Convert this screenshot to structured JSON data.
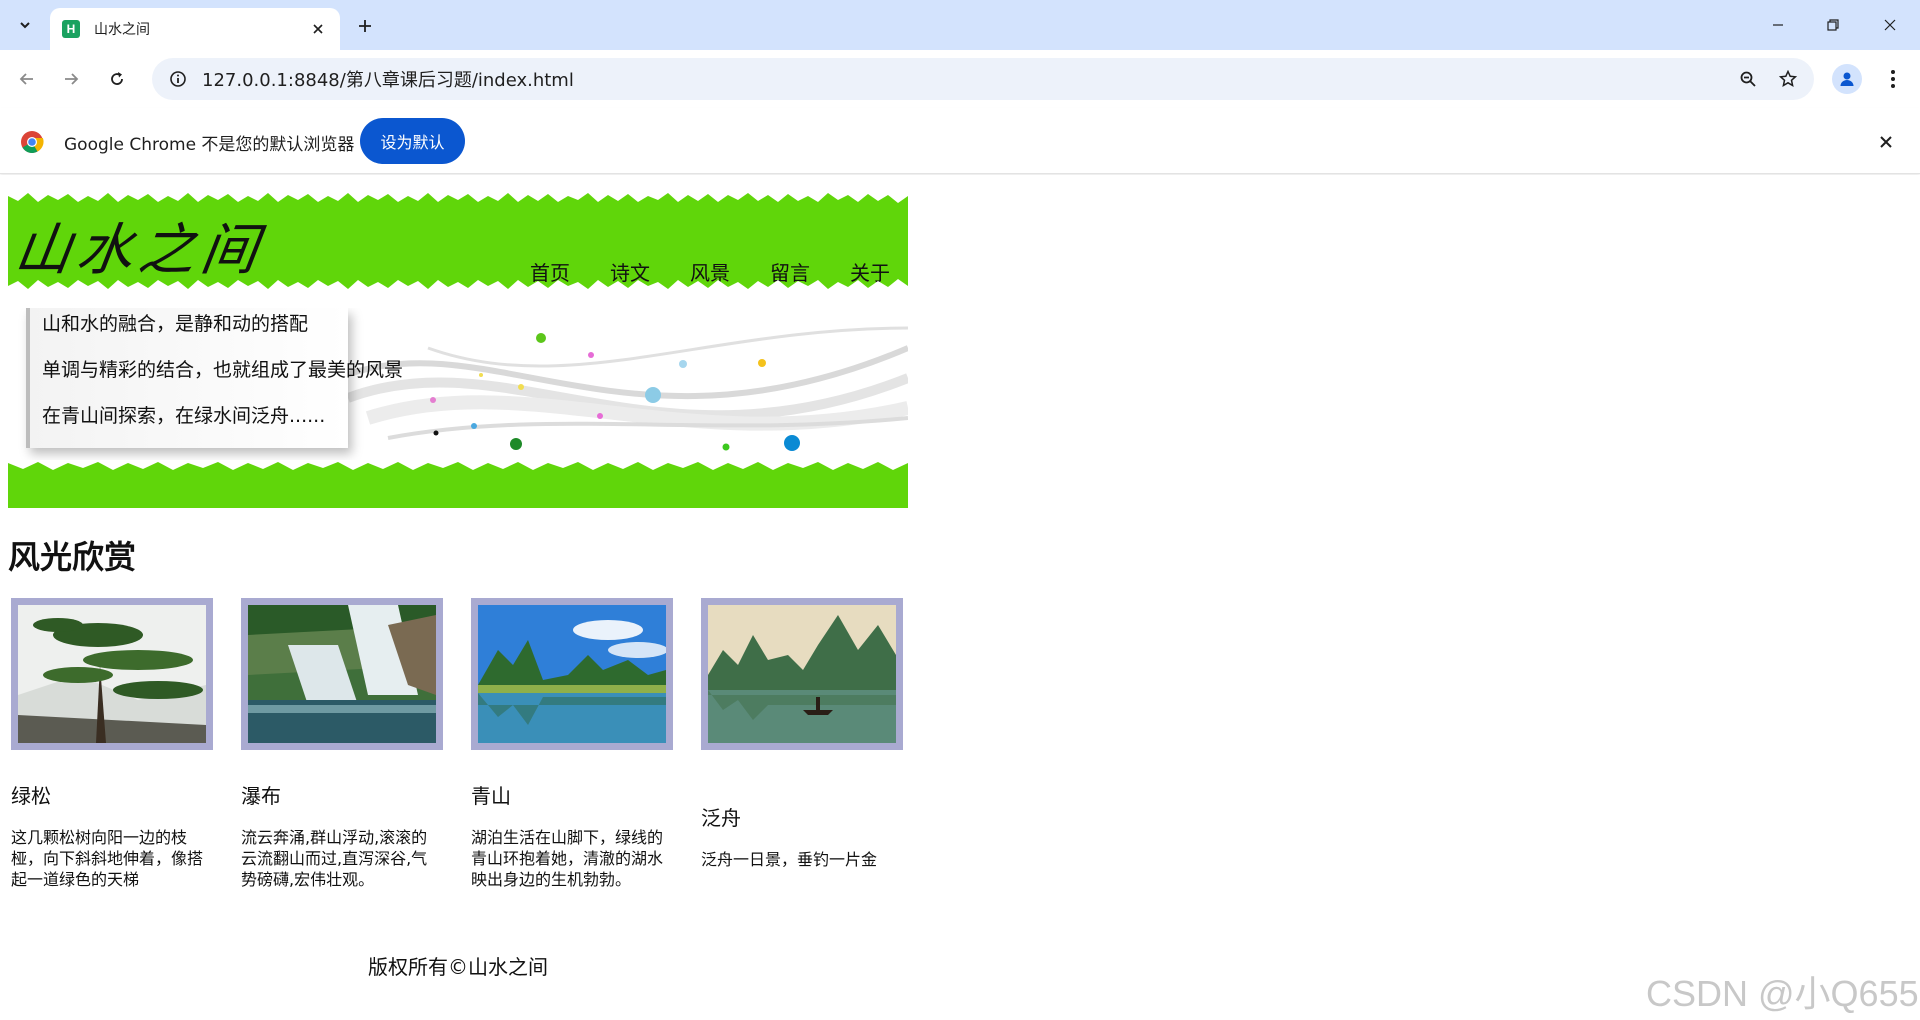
{
  "browser": {
    "tab_title": "山水之间",
    "tab_favicon_letter": "H",
    "url": "127.0.0.1:8848/第八章课后习题/index.html",
    "infobar_text": "Google Chrome 不是您的默认浏览器",
    "infobar_button": "设为默认",
    "accent_color": "#0b57d0"
  },
  "site": {
    "logo": "山水之间",
    "nav": [
      "首页",
      "诗文",
      "风景",
      "留言",
      "关于"
    ],
    "banner_lines": [
      "山和水的融合，是静和动的搭配",
      "单调与精彩的结合，也就组成了最美的风景",
      "在青山间探索，在绿水间泛舟......"
    ],
    "section_title": "风光欣赏",
    "gallery": [
      {
        "name": "绿松",
        "desc": "这几颗松树向阳一边的枝桠，向下斜斜地伸着，像搭起一道绿色的天梯"
      },
      {
        "name": "瀑布",
        "desc": "流云奔涌,群山浮动,滚滚的云流翻山而过,直泻深谷,气势磅礴,宏伟壮观。"
      },
      {
        "name": "青山",
        "desc": "湖泊生活在山脚下，绿线的青山环抱着她，清澈的湖水映出身边的生机勃勃。"
      },
      {
        "name": "泛舟",
        "desc": "泛舟一日景，垂钓一片金"
      }
    ],
    "footer": "版权所有©山水之间",
    "header_color": "#60d60a"
  },
  "watermark": "CSDN @小Q655"
}
